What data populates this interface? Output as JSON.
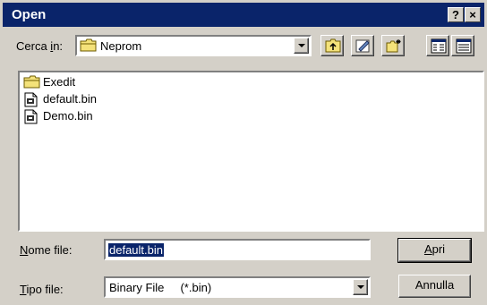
{
  "window": {
    "title": "Open",
    "help_label": "?",
    "close_label": "×"
  },
  "lookin": {
    "label_pre": "Cerca ",
    "label_acc": "i",
    "label_post": "n:",
    "folder": "Neprom",
    "folder_icon": "folder-icon"
  },
  "toolbar": {
    "items": [
      "up-folder-icon",
      "desktop-icon",
      "new-folder-icon",
      "list-view-icon",
      "details-view-icon"
    ]
  },
  "files": [
    {
      "name": "Exedit",
      "icon": "folder-icon"
    },
    {
      "name": "default.bin",
      "icon": "file-icon"
    },
    {
      "name": "Demo.bin",
      "icon": "file-icon"
    }
  ],
  "filename": {
    "label_acc": "N",
    "label_rest": "ome file:",
    "value": "default.bin"
  },
  "filetype": {
    "label_acc": "T",
    "label_rest": "ipo file:",
    "value": "Binary File     (*.bin)"
  },
  "buttons": {
    "open_acc": "A",
    "open_rest": "pri",
    "cancel": "Annulla"
  },
  "colors": {
    "titlebar": "#0a246a",
    "face": "#d4d0c8",
    "selection": "#0a246a"
  }
}
